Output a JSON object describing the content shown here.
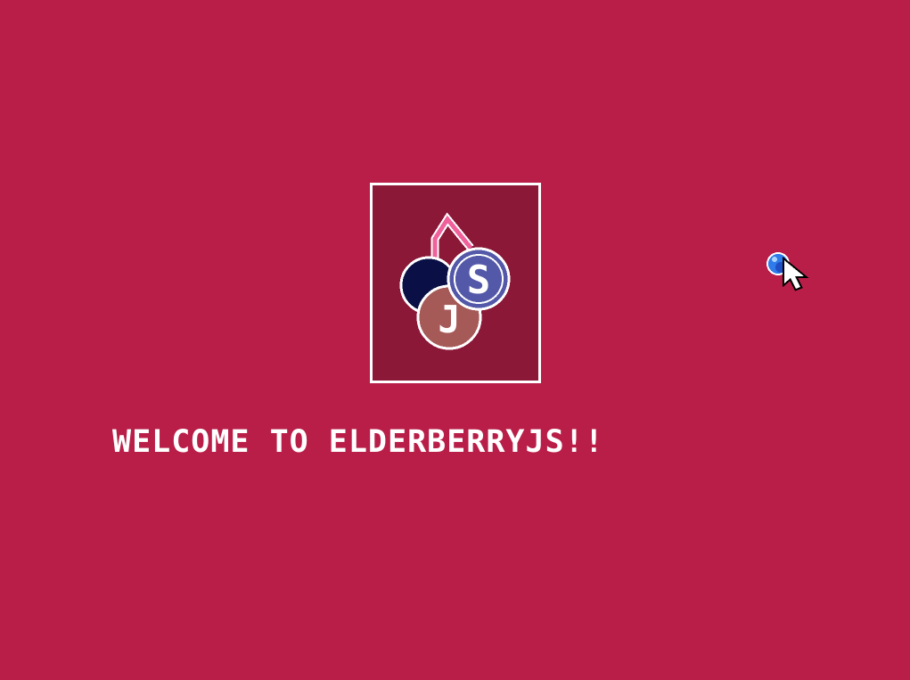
{
  "screen": {
    "background_color": "#b91e48",
    "welcome_text": "WELCOME TO ELDERBERRYJS!!"
  },
  "logo": {
    "frame_color": "#8c1838",
    "border_color": "#ffffff",
    "letter_s": "S",
    "letter_j": "J",
    "colors": {
      "stem": "#f0609a",
      "dark_berry": "#0a0f45",
      "s_berry": "#5359a8",
      "j_berry": "#a65a58"
    }
  },
  "cursor": {
    "icon": "arrow-cursor-with-blueberry",
    "berry_color": "#2f7bea"
  }
}
